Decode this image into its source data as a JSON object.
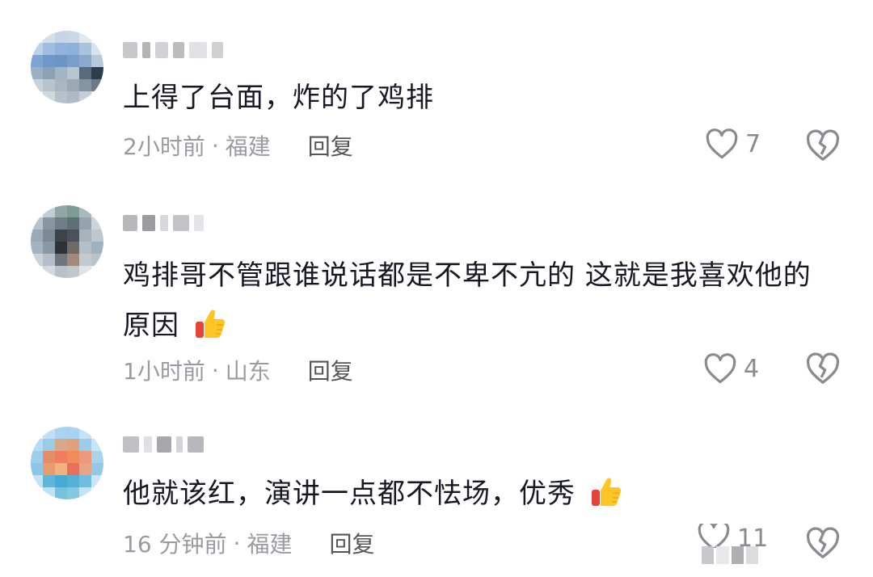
{
  "comments": [
    {
      "text": "上得了台面，炸的了鸡排",
      "time": "2小时前",
      "location": "福建",
      "reply": "回复",
      "likes": "7",
      "emoji": ""
    },
    {
      "text": "鸡排哥不管跟谁说话都是不卑不亢的 这就是我喜欢他的原因",
      "time": "1小时前",
      "location": "山东",
      "reply": "回复",
      "likes": "4",
      "emoji": "thumbs-up"
    },
    {
      "text": "他就该红，演讲一点都不怯场，优秀",
      "time": "16 分钟前",
      "location": "福建",
      "reply": "回复",
      "likes": "11",
      "emoji": "thumbs-up"
    }
  ],
  "separator": "·",
  "colors": {
    "text": "#161823",
    "meta": "#9a9aa0",
    "reply": "#555558",
    "icon": "#8a8a90"
  },
  "icons": {
    "like": "heart-outline-icon",
    "dislike": "broken-heart-icon",
    "emoji": "thumbs-up-emoji"
  }
}
